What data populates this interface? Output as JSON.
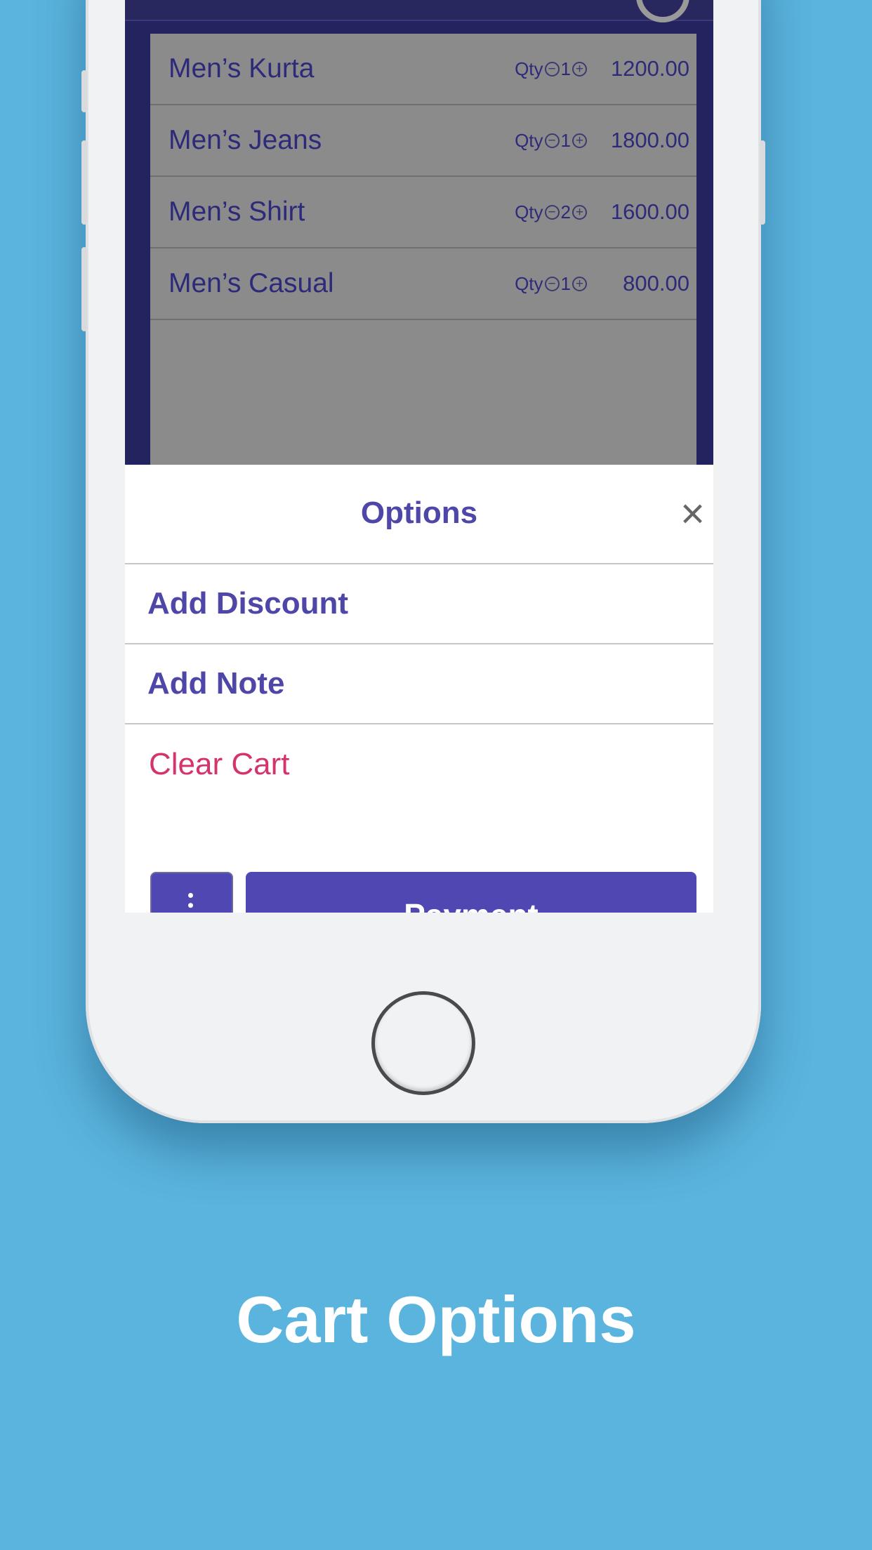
{
  "cart": {
    "items": [
      {
        "name": "Men’s Kurta",
        "qty_label": "Qty",
        "qty": "1",
        "price": "1200.00"
      },
      {
        "name": "Men’s Jeans",
        "qty_label": "Qty",
        "qty": "1",
        "price": "1800.00"
      },
      {
        "name": "Men’s Shirt",
        "qty_label": "Qty",
        "qty": "2",
        "price": "1600.00"
      },
      {
        "name": "Men’s Casual",
        "qty_label": "Qty",
        "qty": "1",
        "price": "800.00"
      }
    ],
    "decrement_icon": "minus-circle-icon",
    "increment_icon": "plus-circle-icon"
  },
  "options_sheet": {
    "title": "Options",
    "close_icon": "×",
    "add_discount": "Add Discount",
    "add_note": "Add Note",
    "clear_cart": "Clear Cart"
  },
  "bottom_bar": {
    "more_icon": "vertical-dots-icon",
    "payment_label": "Payment"
  },
  "caption": "Cart Options",
  "colors": {
    "background": "#5ab4dd",
    "accent": "#4f47b2",
    "danger": "#d6326d",
    "screen_header": "#232360"
  }
}
